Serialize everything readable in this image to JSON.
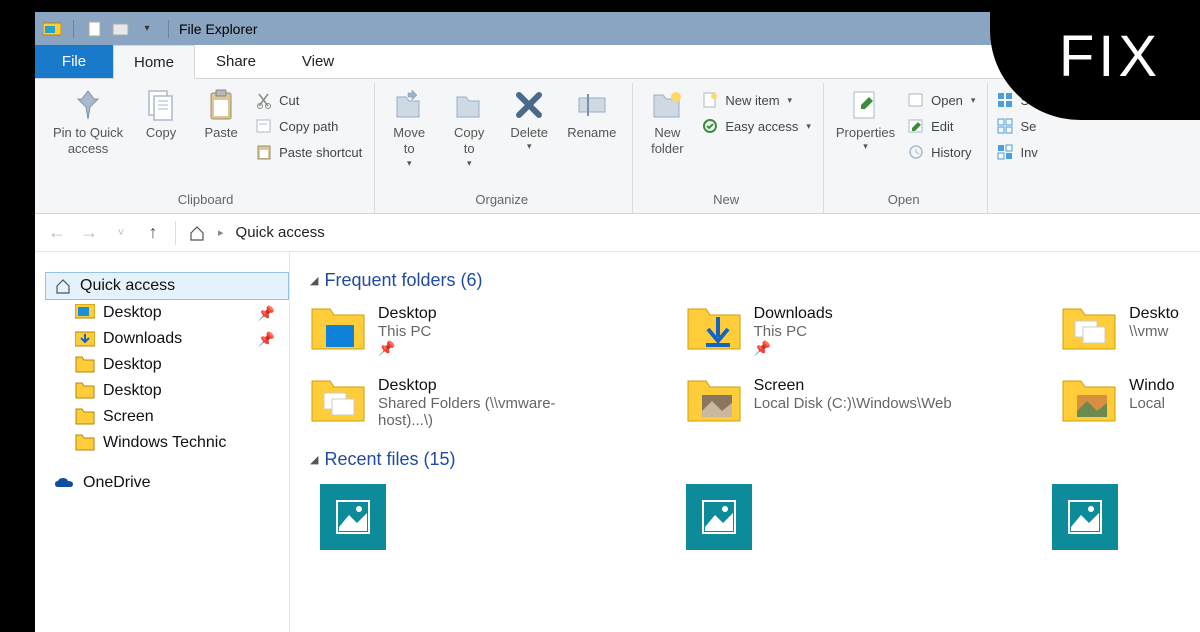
{
  "badge": "FIX",
  "window_title": "File Explorer",
  "menu": {
    "file": "File",
    "tabs": [
      "Home",
      "Share",
      "View"
    ],
    "active": 0
  },
  "ribbon": {
    "clipboard": {
      "label": "Clipboard",
      "pin": "Pin to Quick\naccess",
      "copy": "Copy",
      "paste": "Paste",
      "cut": "Cut",
      "copy_path": "Copy path",
      "paste_shortcut": "Paste shortcut"
    },
    "organize": {
      "label": "Organize",
      "move_to": "Move\nto",
      "copy_to": "Copy\nto",
      "delete": "Delete",
      "rename": "Rename"
    },
    "new": {
      "label": "New",
      "new_folder": "New\nfolder",
      "new_item": "New item",
      "easy_access": "Easy access"
    },
    "open": {
      "label": "Open",
      "properties": "Properties",
      "open": "Open",
      "edit": "Edit",
      "history": "History"
    },
    "select": {
      "sel": "Se",
      "sel2": "Se",
      "inv": "Inv"
    }
  },
  "address": {
    "crumb": "Quick access"
  },
  "sidebar": {
    "quick_access": "Quick access",
    "items": [
      {
        "label": "Desktop",
        "pinned": true,
        "icon": "monitor"
      },
      {
        "label": "Downloads",
        "pinned": true,
        "icon": "download"
      },
      {
        "label": "Desktop",
        "pinned": false,
        "icon": "folder"
      },
      {
        "label": "Desktop",
        "pinned": false,
        "icon": "folder"
      },
      {
        "label": "Screen",
        "pinned": false,
        "icon": "folder"
      },
      {
        "label": "Windows Technic",
        "pinned": false,
        "icon": "folder"
      }
    ],
    "onedrive": "OneDrive"
  },
  "content": {
    "frequent_hdr": "Frequent folders (6)",
    "recent_hdr": "Recent files (15)",
    "folders": [
      [
        {
          "name": "Desktop",
          "loc": "This PC",
          "pinned": true,
          "icon": "desktop"
        },
        {
          "name": "Downloads",
          "loc": "This PC",
          "pinned": true,
          "icon": "download"
        },
        {
          "name": "Deskto",
          "loc": "\\\\vmw",
          "pinned": false,
          "icon": "thumbs"
        }
      ],
      [
        {
          "name": "Desktop",
          "loc": "Shared Folders (\\\\vmware-host)...\\)",
          "pinned": false,
          "icon": "thumbs"
        },
        {
          "name": "Screen",
          "loc": "Local Disk (C:)\\Windows\\Web",
          "pinned": false,
          "icon": "photo"
        },
        {
          "name": "Windo",
          "loc": "Local ",
          "pinned": false,
          "icon": "photo2"
        }
      ]
    ]
  }
}
